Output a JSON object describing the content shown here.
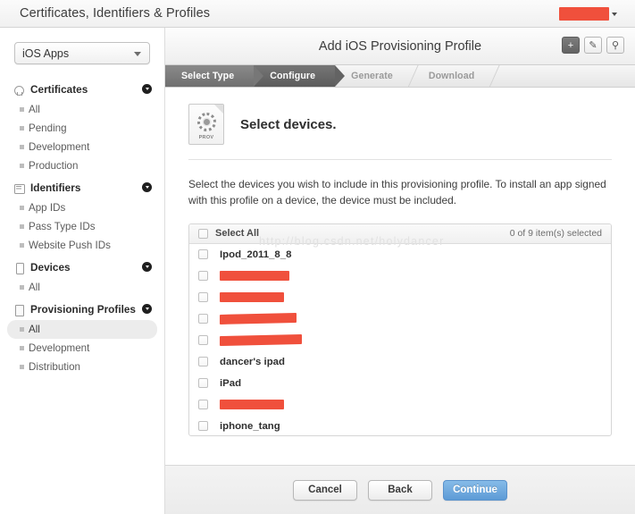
{
  "window": {
    "title": "Certificates, Identifiers & Profiles",
    "account_redacted": true,
    "caret_icon": "chevron-down-icon"
  },
  "colors": {
    "redaction": "#f0503c",
    "primary_button": "#5d9bd6",
    "step_active": "#5b5b5b",
    "step_done": "#6f6f6f"
  },
  "sidebar": {
    "app_select": {
      "value": "iOS Apps"
    },
    "groups": [
      {
        "label": "Certificates",
        "icon": "certificate-icon",
        "collapse_icon": "chevron-down-icon",
        "items": [
          {
            "label": "All",
            "selected": false
          },
          {
            "label": "Pending",
            "selected": false
          },
          {
            "label": "Development",
            "selected": false
          },
          {
            "label": "Production",
            "selected": false
          }
        ]
      },
      {
        "label": "Identifiers",
        "icon": "identifier-card-icon",
        "collapse_icon": "chevron-down-icon",
        "items": [
          {
            "label": "App IDs",
            "selected": false
          },
          {
            "label": "Pass Type IDs",
            "selected": false
          },
          {
            "label": "Website Push IDs",
            "selected": false
          }
        ]
      },
      {
        "label": "Devices",
        "icon": "device-phone-icon",
        "collapse_icon": "chevron-down-icon",
        "items": [
          {
            "label": "All",
            "selected": false
          }
        ]
      },
      {
        "label": "Provisioning Profiles",
        "icon": "document-icon",
        "collapse_icon": "chevron-down-icon",
        "items": [
          {
            "label": "All",
            "selected": true
          },
          {
            "label": "Development",
            "selected": false
          },
          {
            "label": "Distribution",
            "selected": false
          }
        ]
      }
    ]
  },
  "content": {
    "title": "Add iOS Provisioning Profile",
    "actions": [
      {
        "name": "add-button",
        "icon": "plus-icon",
        "glyph": "+",
        "active": true
      },
      {
        "name": "edit-button",
        "icon": "pencil-edit-icon",
        "glyph": "✎",
        "active": false
      },
      {
        "name": "search-button",
        "icon": "search-icon",
        "glyph": "⚲",
        "active": false
      }
    ],
    "steps": [
      {
        "label": "Select Type",
        "state": "done"
      },
      {
        "label": "Configure",
        "state": "current"
      },
      {
        "label": "Generate",
        "state": "todo"
      },
      {
        "label": "Download",
        "state": "todo"
      }
    ],
    "section": {
      "icon_name": "provisioning-profile-icon",
      "icon_label": "PROV",
      "title": "Select devices.",
      "description": "Select the devices you wish to include in this provisioning profile. To install an app signed with this profile on a device, the device must be included."
    },
    "device_list": {
      "select_all_label": "Select All",
      "selection_count": "0 of 9 item(s) selected",
      "watermark": "http://blog.csdn.net/holydancer",
      "rows": [
        {
          "label": "Ipod_2011_8_8",
          "redacted": false,
          "checked": false,
          "redaction_width": 0
        },
        {
          "label": "",
          "redacted": true,
          "checked": false,
          "redaction_width": 78
        },
        {
          "label": "",
          "redacted": true,
          "checked": false,
          "redaction_width": 72
        },
        {
          "label": "",
          "redacted": true,
          "checked": false,
          "redaction_width": 86
        },
        {
          "label": "",
          "redacted": true,
          "checked": false,
          "redaction_width": 92
        },
        {
          "label": "dancer's ipad",
          "redacted": false,
          "checked": false,
          "redaction_width": 0
        },
        {
          "label": "iPad",
          "redacted": false,
          "checked": false,
          "redaction_width": 0
        },
        {
          "label": "",
          "redacted": true,
          "checked": false,
          "redaction_width": 72
        },
        {
          "label": "iphone_tang",
          "redacted": false,
          "checked": false,
          "redaction_width": 0
        }
      ]
    },
    "footer": {
      "cancel_label": "Cancel",
      "back_label": "Back",
      "continue_label": "Continue"
    }
  }
}
